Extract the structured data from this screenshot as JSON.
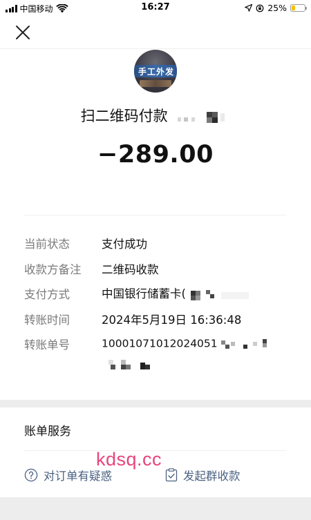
{
  "status_bar": {
    "carrier": "中国移动",
    "time": "16:27",
    "battery": "25%",
    "battery_level": 0.25
  },
  "header": {
    "close_icon": "close-icon"
  },
  "merchant": {
    "avatar_text": "手工外发",
    "title": "扫二维码付款"
  },
  "amount": "−289.00",
  "details": [
    {
      "label": "当前状态",
      "value": "支付成功"
    },
    {
      "label": "收款方备注",
      "value": "二维码收款"
    },
    {
      "label": "支付方式",
      "value": "中国银行储蓄卡("
    },
    {
      "label": "转账时间",
      "value": "2024年5月19日 16:36:48"
    },
    {
      "label": "转账单号",
      "value": "10001071012024051"
    }
  ],
  "services": {
    "title": "账单服务",
    "watermark": "kdsq.cc",
    "actions": [
      {
        "label": "对订单有疑惑",
        "icon": "question-circle-icon"
      },
      {
        "label": "发起群收款",
        "icon": "clipboard-check-icon"
      }
    ]
  },
  "colors": {
    "link": "#4b6181",
    "watermark": "#e8447a",
    "background": "#ededed"
  }
}
